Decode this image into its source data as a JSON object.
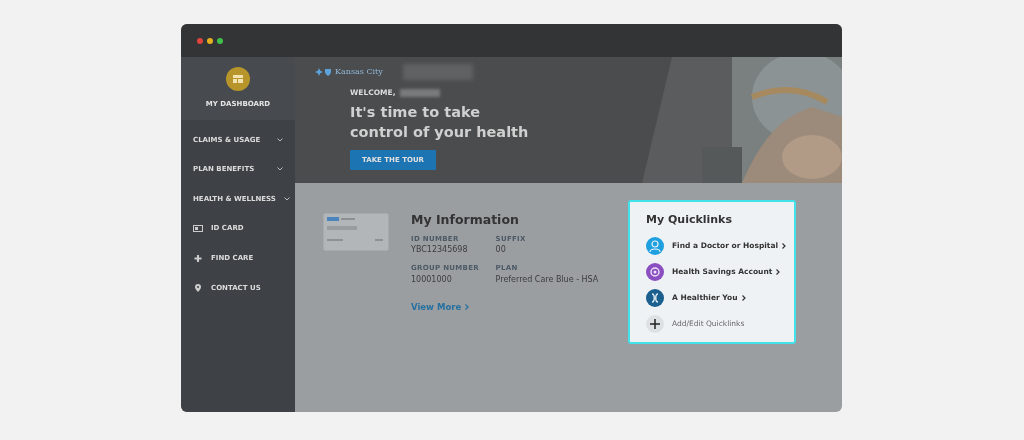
{
  "sidebar": {
    "dashboard": "MY DASHBOARD",
    "items": [
      {
        "label": "CLAIMS & USAGE",
        "kind": "menu"
      },
      {
        "label": "PLAN BENEFITS",
        "kind": "menu"
      },
      {
        "label": "HEALTH & WELLNESS",
        "kind": "menu"
      },
      {
        "label": "ID CARD",
        "kind": "link"
      },
      {
        "label": "FIND CARE",
        "kind": "link"
      },
      {
        "label": "CONTACT US",
        "kind": "link"
      }
    ]
  },
  "hero": {
    "logo_text": "Kansas City",
    "welcome": "WELCOME,",
    "headline": [
      "It's time to take",
      "control of your health"
    ],
    "button": "TAKE THE TOUR"
  },
  "info": {
    "title": "My Information",
    "fields": [
      {
        "label": "ID NUMBER",
        "value": "YBC12345698"
      },
      {
        "label": "SUFFIX",
        "value": "00"
      },
      {
        "label": "GROUP NUMBER",
        "value": "10001000"
      },
      {
        "label": "PLAN",
        "value": "Preferred Care Blue - HSA"
      }
    ],
    "link": "View More"
  },
  "quicklinks": {
    "title": "My Quicklinks",
    "items": [
      {
        "label": "Find a Doctor or Hospital",
        "color": "#1e9fe0"
      },
      {
        "label": "Health Savings Account",
        "color": "#8a4fc0"
      },
      {
        "label": "A Healthier You",
        "color": "#1a5f8e"
      }
    ],
    "add": "Add/Edit Quicklinks"
  }
}
